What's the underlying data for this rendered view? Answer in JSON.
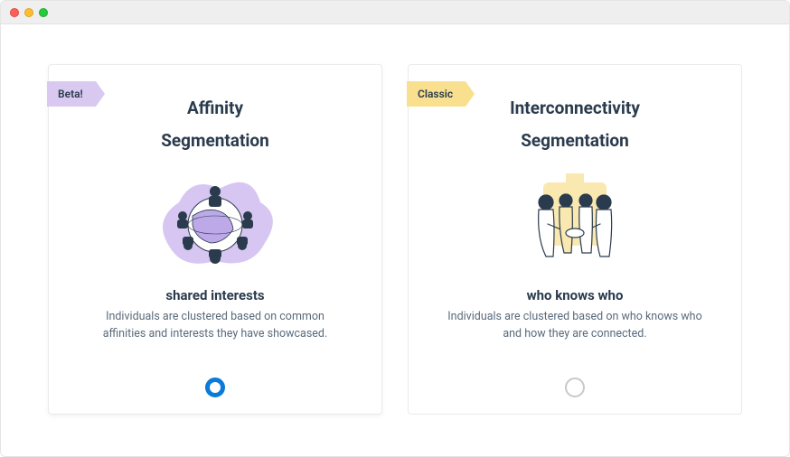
{
  "cards": [
    {
      "ribbon": "Beta!",
      "title_line1": "Affinity",
      "title_line2": "Segmentation",
      "subtitle": "shared interests",
      "description": "Individuals are clustered based on common affinities and interests they have showcased.",
      "selected": true
    },
    {
      "ribbon": "Classic",
      "title_line1": "Interconnectivity",
      "title_line2": "Segmentation",
      "subtitle": "who knows who",
      "description": "Individuals are clustered based on who knows who and how they are connected.",
      "selected": false
    }
  ]
}
